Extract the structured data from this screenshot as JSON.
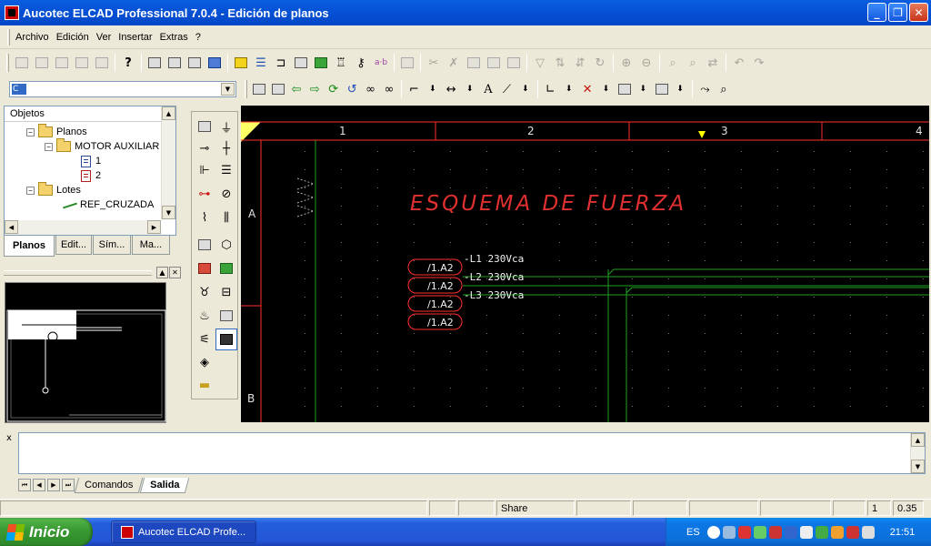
{
  "window": {
    "title": "Aucotec ELCAD Professional 7.0.4 - Edición de planos",
    "minimize": "_",
    "restore": "❐",
    "close": "✕"
  },
  "menu": [
    "Archivo",
    "Edición",
    "Ver",
    "Insertar",
    "Extras",
    "?"
  ],
  "combo": {
    "value": "C"
  },
  "objects_panel": {
    "header": "Objetos",
    "tree": [
      {
        "label": "Planos",
        "toggle": "−"
      },
      {
        "label": "MOTOR AUXILIAR",
        "toggle": "−"
      },
      {
        "label": "1"
      },
      {
        "label": "2"
      },
      {
        "label": "Lotes",
        "toggle": "−"
      },
      {
        "label": "REF_CRUZADA"
      }
    ]
  },
  "left_tabs": [
    "Planos",
    "Edit...",
    "Sím...",
    "Ma..."
  ],
  "drawing": {
    "columns": [
      "1",
      "2",
      "3",
      "4"
    ],
    "rows": [
      "A",
      "B"
    ],
    "title": "ESQUEMA DE FUERZA",
    "refs": [
      "/1.A2",
      "/1.A2",
      "/1.A2",
      "/1.A2"
    ],
    "lines": [
      "-L1 230Vca",
      "-L2 230Vca",
      "-L3 230Vca"
    ],
    "colors": {
      "background": "#000000",
      "frame": "#ff3030",
      "grid_line": "#1fa01f",
      "title": "#e03030",
      "text": "#f0f0f0",
      "ref": "#ff3030",
      "marker": "#ffff00"
    }
  },
  "output_panel": {
    "close": "x",
    "tabs": [
      "Comandos",
      "Salida"
    ]
  },
  "statusbar": {
    "share": "Share",
    "page": "1",
    "zoom": "0.35"
  },
  "taskbar": {
    "start": "Inicio",
    "task": "Aucotec ELCAD Profe...",
    "lang": "ES",
    "clock": "21:51"
  }
}
